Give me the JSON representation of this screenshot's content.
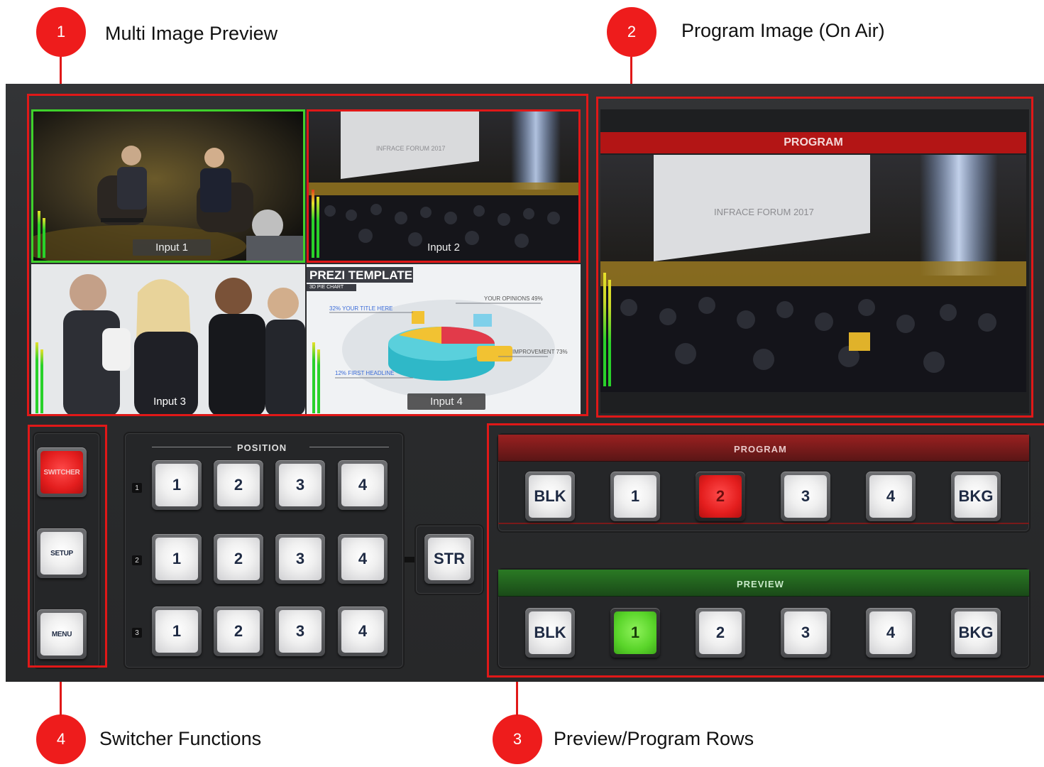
{
  "callouts": [
    {
      "number": "1",
      "label": "Multi Image Preview"
    },
    {
      "number": "2",
      "label": "Program Image (On Air)"
    },
    {
      "number": "3",
      "label": "Preview/Program Rows"
    },
    {
      "number": "4",
      "label": "Switcher Functions"
    }
  ],
  "multiview": {
    "inputs": [
      "Input 1",
      "Input 2",
      "Input 3",
      "Input 4"
    ],
    "slide": {
      "title": "PREZI TEMPLATE",
      "subtitle": "3D PIE CHART",
      "labels": [
        "YOUR OPINIONS 49%",
        "32% YOUR TITLE HERE",
        "IMPROVEMENT 73%",
        "12% FIRST HEADLINE"
      ]
    }
  },
  "program_monitor": {
    "title": "PROGRAM",
    "screen_text": "INFRACE FORUM 2017"
  },
  "stage_screen_text": "INFRACE FORUM 2017",
  "functions": {
    "switcher": "SWITCHER",
    "setup": "SETUP",
    "menu": "MENU"
  },
  "position": {
    "title": "POSITION",
    "rows": [
      {
        "index": "1",
        "keys": [
          "1",
          "2",
          "3",
          "4"
        ]
      },
      {
        "index": "2",
        "keys": [
          "1",
          "2",
          "3",
          "4"
        ]
      },
      {
        "index": "3",
        "keys": [
          "1",
          "2",
          "3",
          "4"
        ]
      }
    ],
    "str": "STR"
  },
  "program_row": {
    "title": "PROGRAM",
    "keys": [
      "BLK",
      "1",
      "2",
      "3",
      "4",
      "BKG"
    ],
    "active": "2"
  },
  "preview_row": {
    "title": "PREVIEW",
    "keys": [
      "BLK",
      "1",
      "2",
      "3",
      "4",
      "BKG"
    ],
    "active": "1"
  },
  "colors": {
    "accent_red": "#e01818",
    "preview_green": "#3fd12c",
    "panel": "#2b2c2e"
  }
}
